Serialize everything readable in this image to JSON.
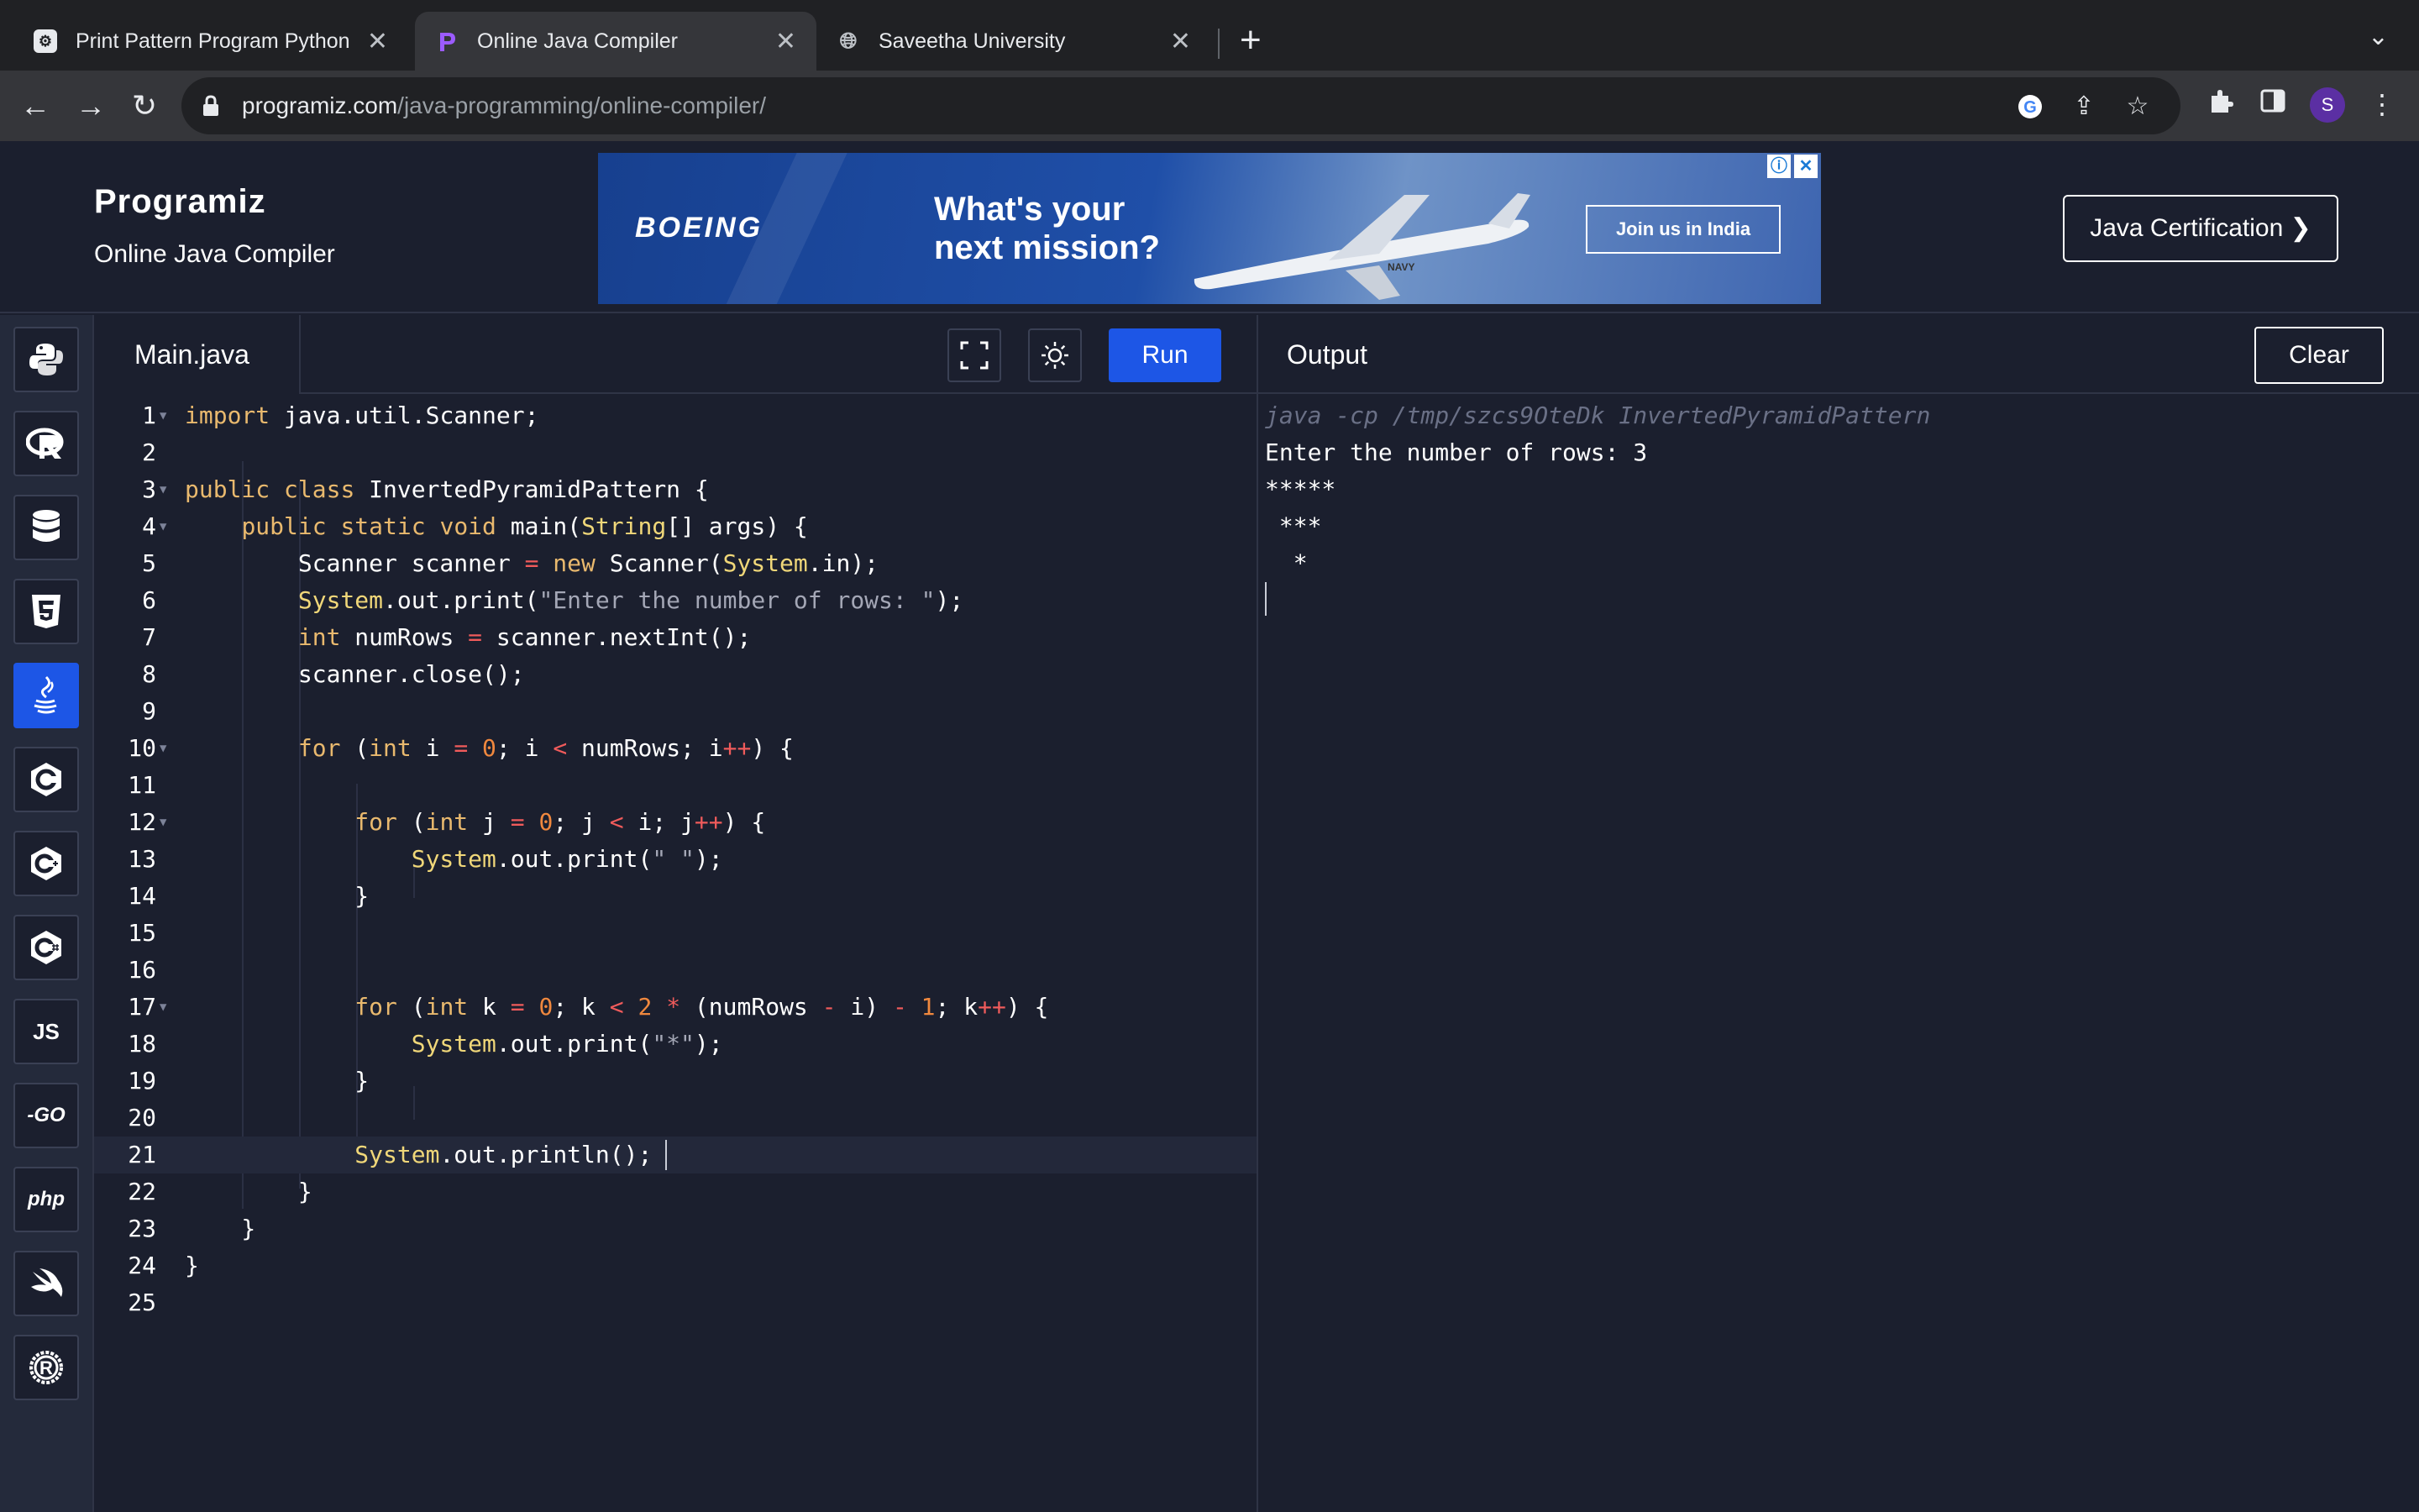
{
  "browser": {
    "tabs": [
      {
        "title": "Print Pattern Program Python",
        "favicon": "chatgpt-icon"
      },
      {
        "title": "Online Java Compiler",
        "favicon": "programiz-icon",
        "active": true
      },
      {
        "title": "Saveetha University",
        "favicon": "globe-icon"
      }
    ],
    "url_host": "programiz.com",
    "url_path": "/java-programming/online-compiler/",
    "profile_initial": "S"
  },
  "site": {
    "logo": "Programiz",
    "subtitle": "Online Java Compiler",
    "cert_button": "Java Certification ❯"
  },
  "ad": {
    "brand": "BOEING",
    "headline_1": "What's your",
    "headline_2": "next mission?",
    "cta": "Join us in India",
    "plane_marking": "NAVY"
  },
  "editor": {
    "file_name": "Main.java",
    "run_label": "Run",
    "current_line": 21
  },
  "output": {
    "title": "Output",
    "clear_label": "Clear",
    "lines": [
      "java -cp /tmp/szcs9OteDk InvertedPyramidPattern",
      "Enter the number of rows: 3",
      "*****",
      " ***",
      "  *"
    ]
  },
  "languages": [
    "Python",
    "R",
    "SQL",
    "HTML",
    "Java",
    "C",
    "C++",
    "C#",
    "JS",
    "GO",
    "php",
    "Swift",
    "Rust"
  ],
  "colors": {
    "accent": "#1d56e6",
    "background": "#1b1f2e",
    "sidebar": "#242a3b"
  }
}
